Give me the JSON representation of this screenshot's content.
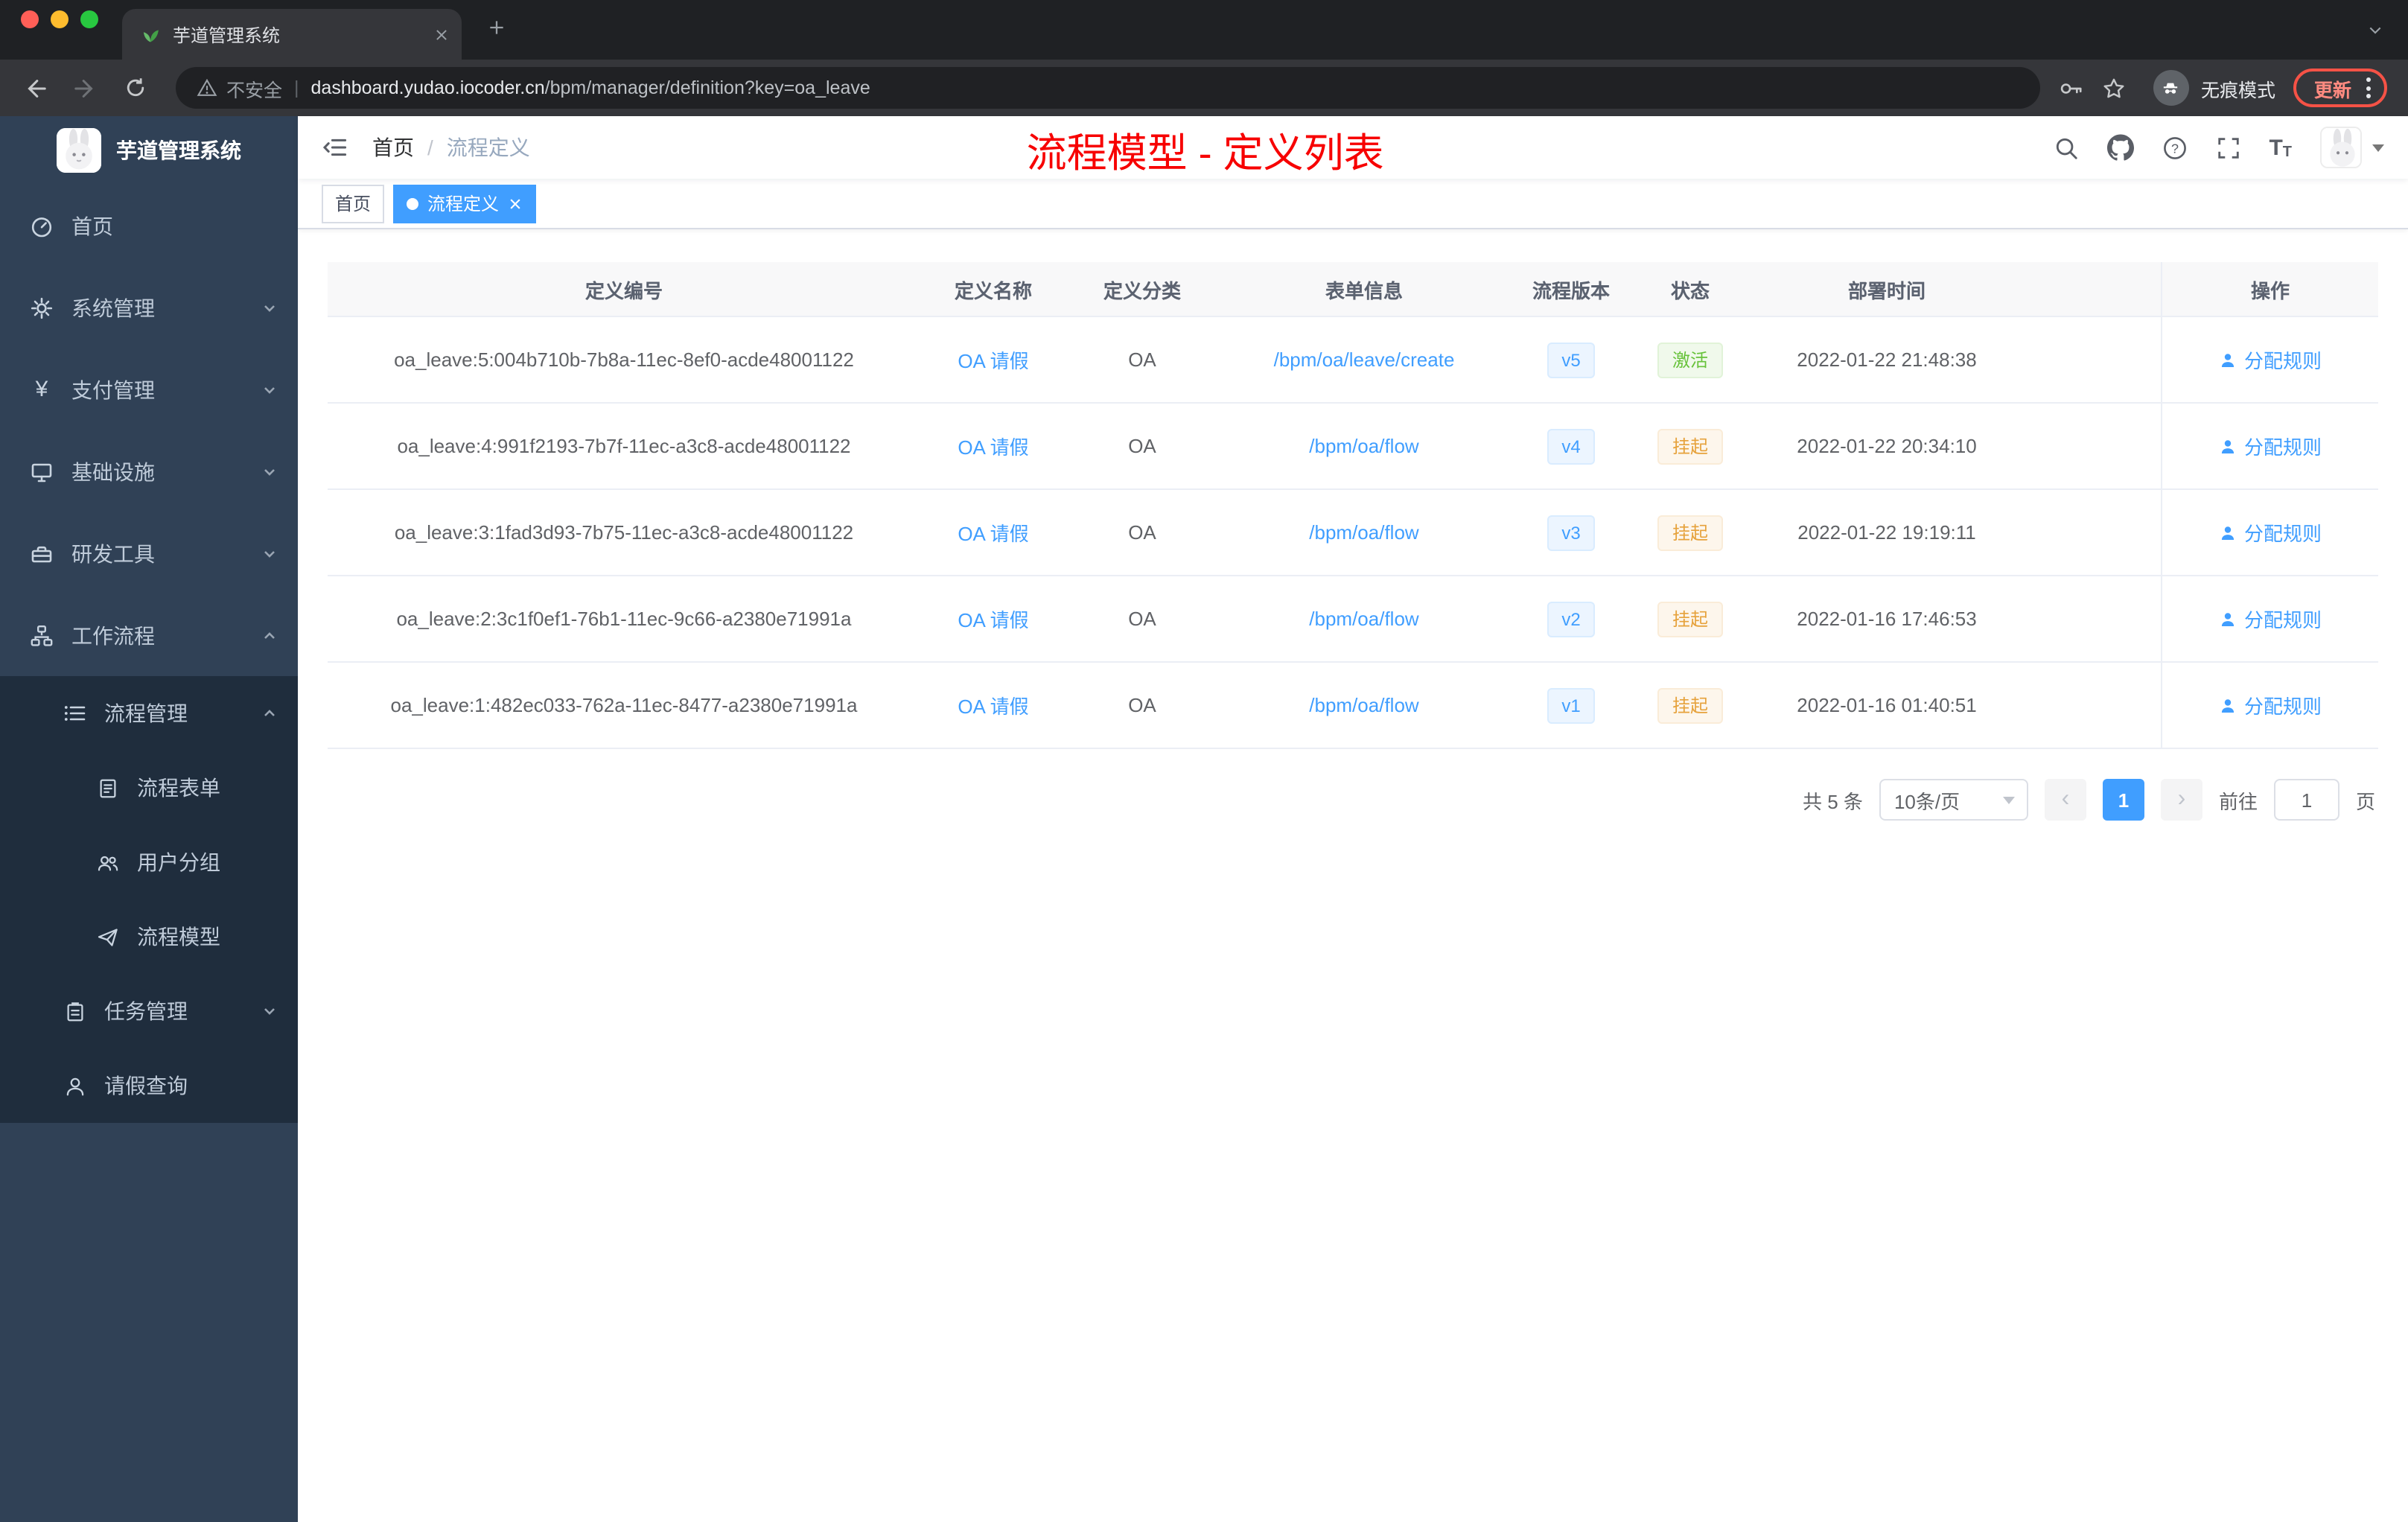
{
  "annotation": {
    "text": "流程模型 - 定义列表",
    "color": "#f70000"
  },
  "browser": {
    "tab": {
      "title": "芋道管理系统"
    },
    "address": {
      "security_label": "不安全",
      "domain": "dashboard.yudao.iocoder.cn",
      "path": "/bpm/manager/definition?key=oa_leave"
    },
    "incognito_label": "无痕模式",
    "update_label": "更新"
  },
  "sidebar": {
    "logo_title": "芋道管理系统",
    "items": [
      {
        "label": "首页"
      },
      {
        "label": "系统管理"
      },
      {
        "label": "支付管理"
      },
      {
        "label": "基础设施"
      },
      {
        "label": "研发工具"
      },
      {
        "label": "工作流程"
      }
    ],
    "submenu": {
      "group": {
        "label": "流程管理"
      },
      "group_children": [
        {
          "label": "流程表单"
        },
        {
          "label": "用户分组"
        },
        {
          "label": "流程模型"
        }
      ],
      "items": [
        {
          "label": "任务管理"
        },
        {
          "label": "请假查询"
        }
      ]
    }
  },
  "header": {
    "breadcrumb": {
      "home": "首页",
      "separator": "/",
      "current": "流程定义"
    }
  },
  "tags": {
    "home": "首页",
    "active": "流程定义"
  },
  "table": {
    "columns": {
      "id": "定义编号",
      "name": "定义名称",
      "category": "定义分类",
      "form": "表单信息",
      "version": "流程版本",
      "status": "状态",
      "deploy_time": "部署时间",
      "actions": "操作"
    },
    "rows": [
      {
        "id": "oa_leave:5:004b710b-7b8a-11ec-8ef0-acde48001122",
        "name": "OA 请假",
        "category": "OA",
        "form": "/bpm/oa/leave/create",
        "version": "v5",
        "status": "激活",
        "deploy_time": "2022-01-22 21:48:38",
        "action": "分配规则"
      },
      {
        "id": "oa_leave:4:991f2193-7b7f-11ec-a3c8-acde48001122",
        "name": "OA 请假",
        "category": "OA",
        "form": "/bpm/oa/flow",
        "version": "v4",
        "status": "挂起",
        "deploy_time": "2022-01-22 20:34:10",
        "action": "分配规则"
      },
      {
        "id": "oa_leave:3:1fad3d93-7b75-11ec-a3c8-acde48001122",
        "name": "OA 请假",
        "category": "OA",
        "form": "/bpm/oa/flow",
        "version": "v3",
        "status": "挂起",
        "deploy_time": "2022-01-22 19:19:11",
        "action": "分配规则"
      },
      {
        "id": "oa_leave:2:3c1f0ef1-76b1-11ec-9c66-a2380e71991a",
        "name": "OA 请假",
        "category": "OA",
        "form": "/bpm/oa/flow",
        "version": "v2",
        "status": "挂起",
        "deploy_time": "2022-01-16 17:46:53",
        "action": "分配规则"
      },
      {
        "id": "oa_leave:1:482ec033-762a-11ec-8477-a2380e71991a",
        "name": "OA 请假",
        "category": "OA",
        "form": "/bpm/oa/flow",
        "version": "v1",
        "status": "挂起",
        "deploy_time": "2022-01-16 01:40:51",
        "action": "分配规则"
      }
    ]
  },
  "pagination": {
    "total": "共 5 条",
    "page_size": "10条/页",
    "current_page": "1",
    "goto_label": "前往",
    "goto_value": "1",
    "page_unit": "页"
  },
  "colors": {
    "primary": "#409eff",
    "status_active": "#67c23a",
    "status_suspended": "#e6a23c",
    "sidebar_bg": "#304156",
    "submenu_bg": "#1f2d3d",
    "annotation_red": "#f70000"
  }
}
